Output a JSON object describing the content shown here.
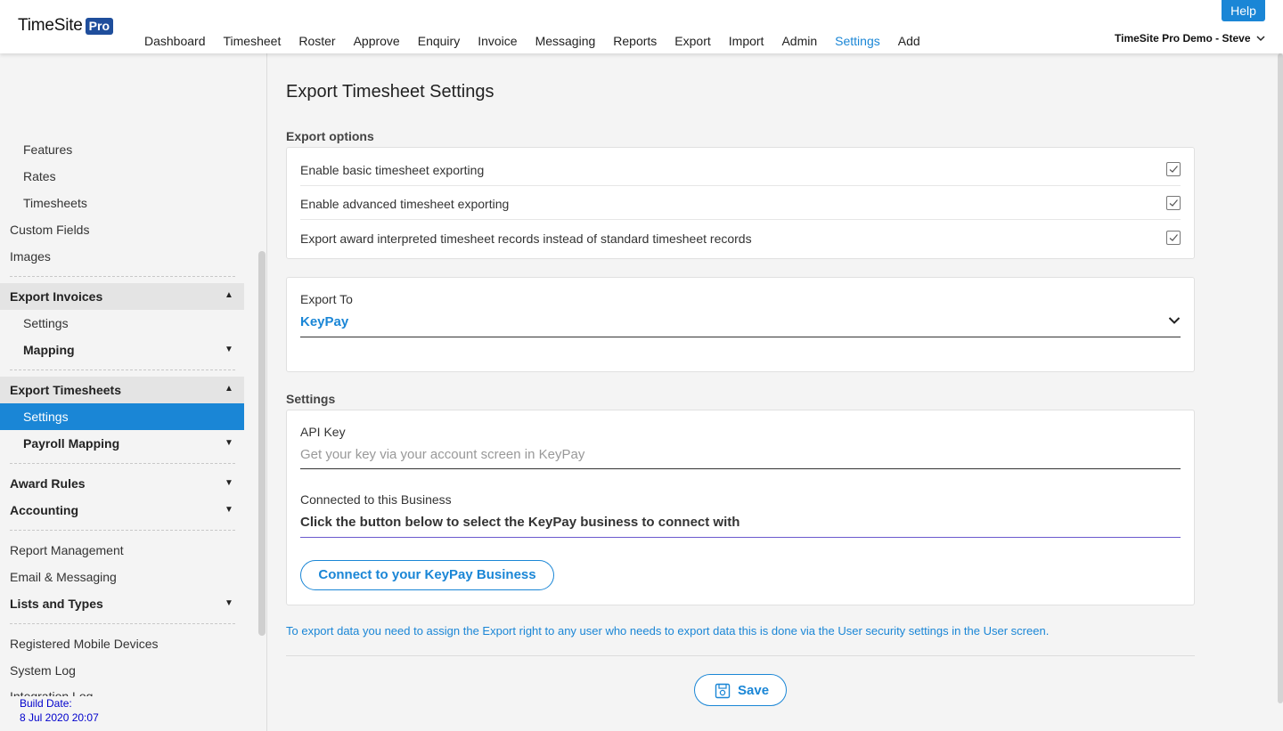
{
  "app": {
    "logo_text": "TimeSite",
    "logo_badge": "Pro"
  },
  "nav": {
    "items": [
      "Dashboard",
      "Timesheet",
      "Roster",
      "Approve",
      "Enquiry",
      "Invoice",
      "Messaging",
      "Reports",
      "Export",
      "Import",
      "Admin",
      "Settings",
      "Add"
    ],
    "active": "Settings",
    "help_label": "Help",
    "user_label": "TimeSite Pro Demo - Steve"
  },
  "sidebar": {
    "features": "Features",
    "rates": "Rates",
    "timesheets": "Timesheets",
    "custom_fields": "Custom Fields",
    "images": "Images",
    "export_invoices": "Export Invoices",
    "invoices_settings": "Settings",
    "invoices_mapping": "Mapping",
    "export_timesheets": "Export Timesheets",
    "timesheets_settings": "Settings",
    "payroll_mapping": "Payroll Mapping",
    "award_rules": "Award Rules",
    "accounting": "Accounting",
    "report_management": "Report Management",
    "email_messaging": "Email & Messaging",
    "lists_and_types": "Lists and Types",
    "registered_mobile_devices": "Registered Mobile Devices",
    "system_log": "System Log",
    "integration_log": "Integration Log",
    "build_label": "Build Date:",
    "build_date": "8 Jul 2020 20:07"
  },
  "main": {
    "title": "Export Timesheet Settings",
    "export_options_label": "Export options",
    "options": [
      {
        "label": "Enable basic timesheet exporting",
        "checked": true
      },
      {
        "label": "Enable advanced timesheet exporting",
        "checked": true
      },
      {
        "label": "Export award interpreted timesheet records instead of standard timesheet records",
        "checked": true
      }
    ],
    "export_to_label": "Export To",
    "export_to_value": "KeyPay",
    "settings_label": "Settings",
    "api_key_label": "API Key",
    "api_key_placeholder": "Get your key via your account screen in KeyPay",
    "connected_label": "Connected to this Business",
    "connected_value": "Click the button below to select the KeyPay business to connect with",
    "connect_button": "Connect to your KeyPay Business",
    "info_text": "To export data you need to assign the Export right to any user who needs to export data this is done via the User security settings in the User screen.",
    "save_button": "Save"
  },
  "colors": {
    "accent": "#1a86d6",
    "logo_badge": "#1f4e9c"
  }
}
